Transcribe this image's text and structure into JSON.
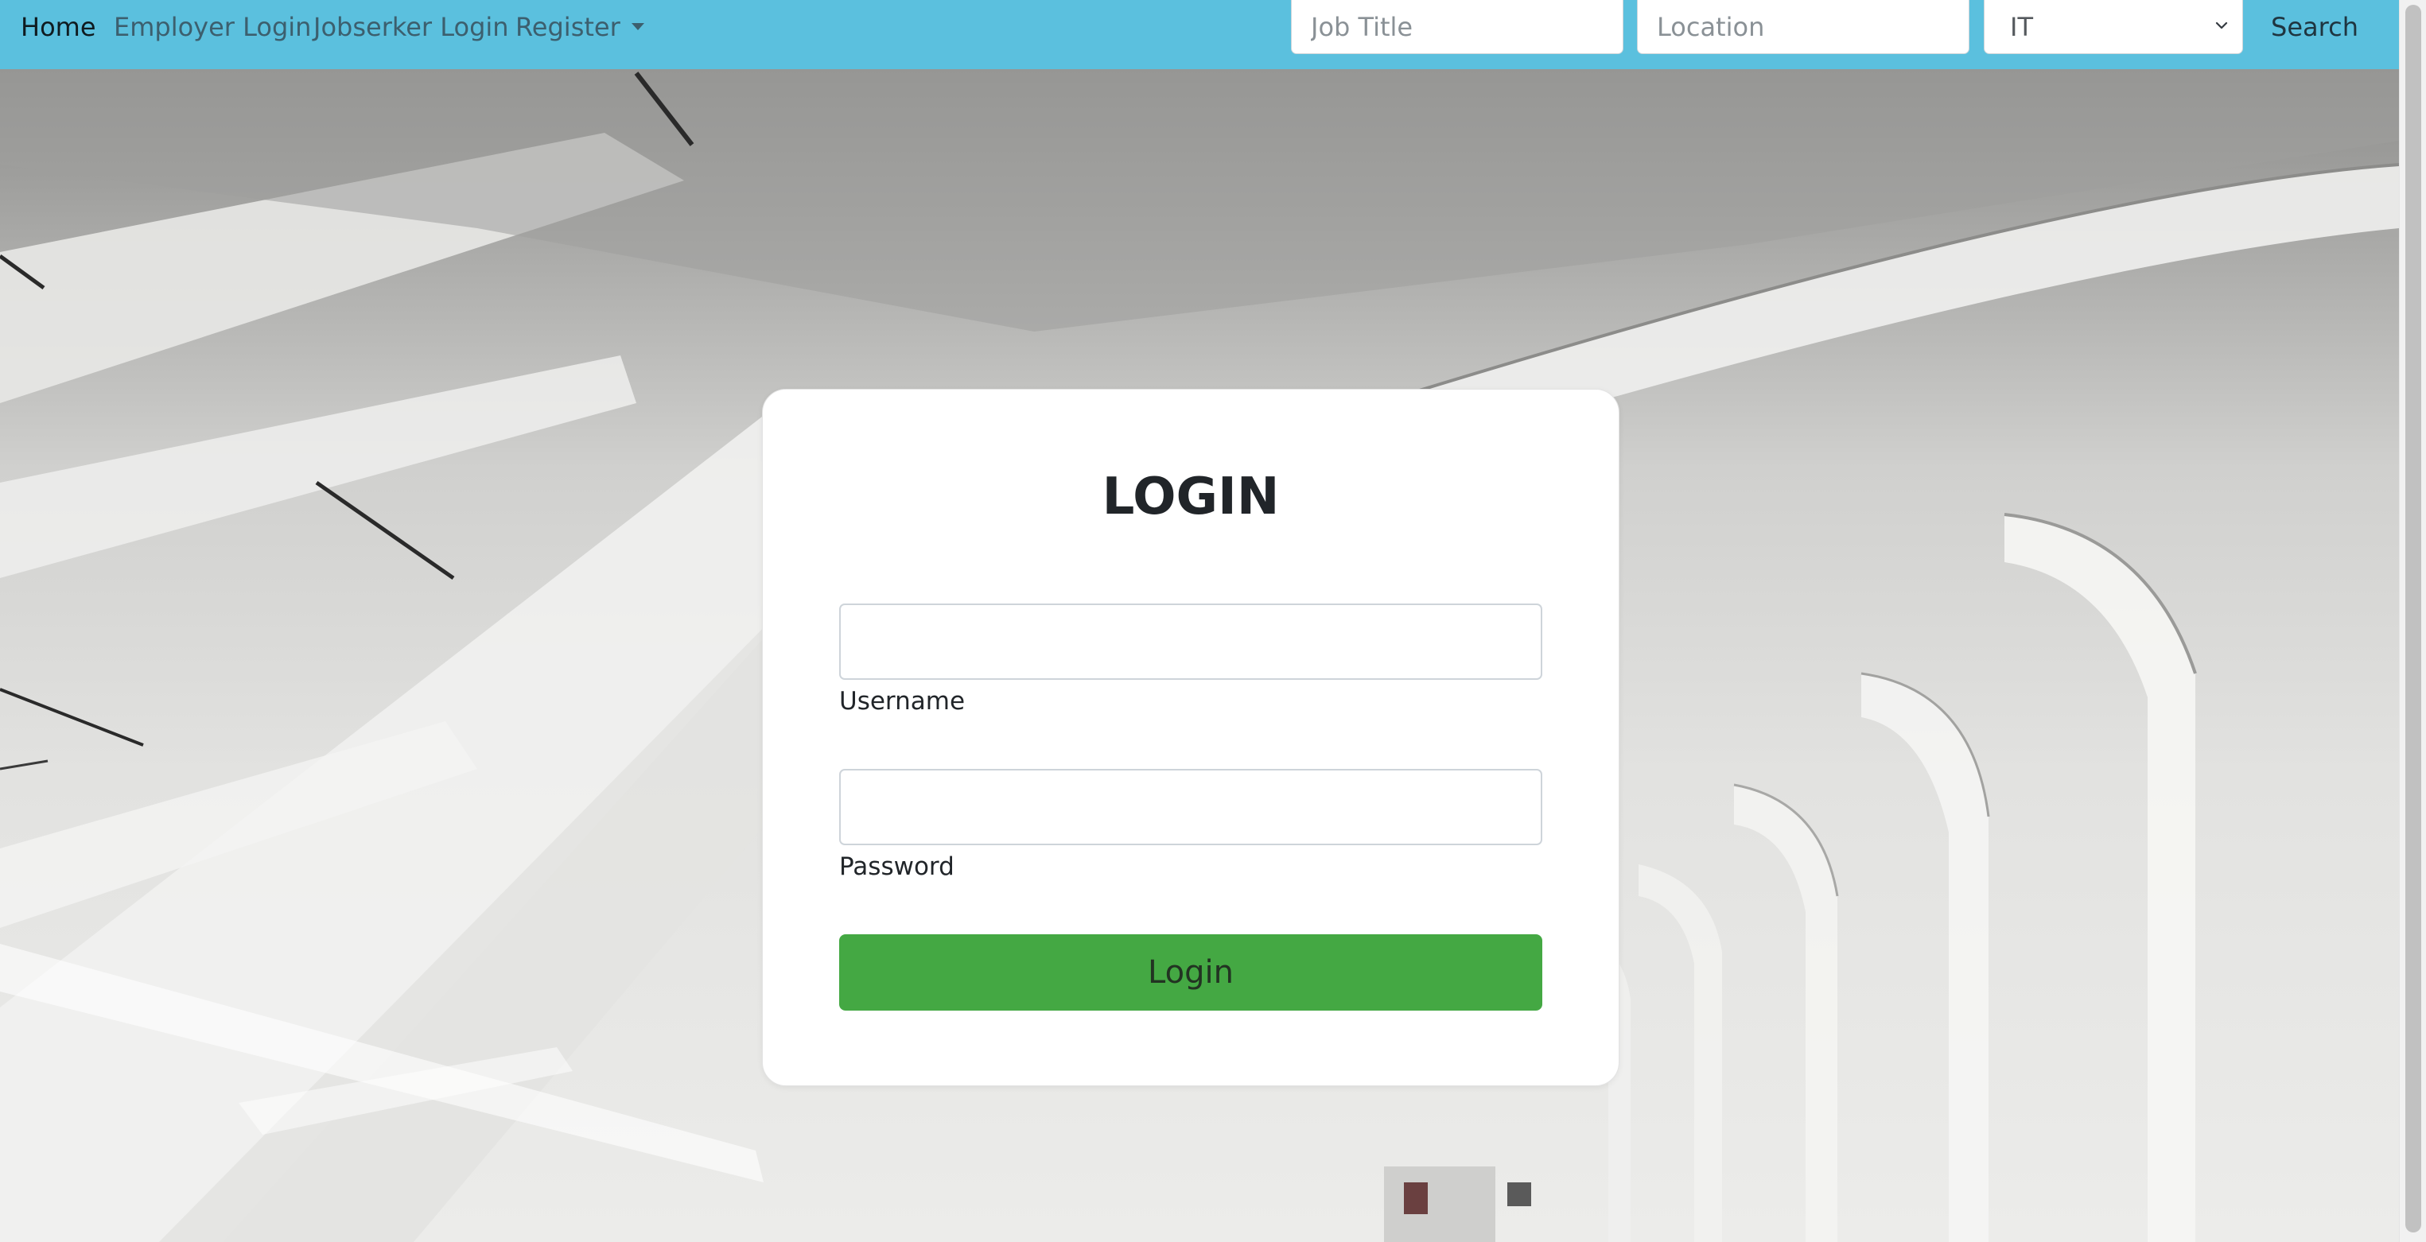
{
  "navbar": {
    "links": {
      "home": "Home",
      "employer_login": "Employer Login",
      "jobseeker_login": "Jobserker Login",
      "register": "Register"
    },
    "search": {
      "job_title_placeholder": "Job Title",
      "location_placeholder": "Location",
      "category_selected": "IT",
      "search_label": "Search"
    },
    "background_color": "#5bc0de"
  },
  "login_card": {
    "title": "LOGIN",
    "username_label": "Username",
    "password_label": "Password",
    "login_button_label": "Login",
    "button_color": "#44a843"
  },
  "icons": {
    "register_dropdown": "caret-down-icon",
    "category_dropdown": "chevron-down-icon"
  }
}
